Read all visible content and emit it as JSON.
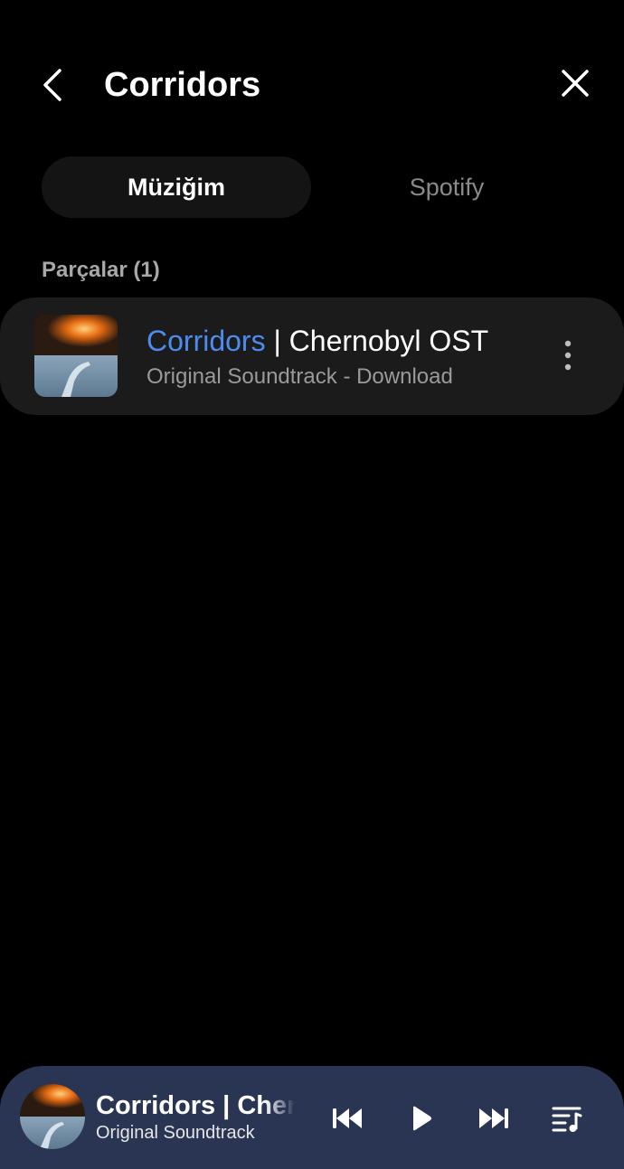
{
  "header": {
    "title": "Corridors",
    "back_icon": "chevron-left-icon",
    "close_icon": "close-icon"
  },
  "tabs": [
    {
      "label": "Müziğim",
      "active": true
    },
    {
      "label": "Spotify",
      "active": false
    }
  ],
  "section": {
    "label": "Parçalar (1)"
  },
  "tracks": [
    {
      "title_match": "Corridors",
      "title_rest": " | Chernobyl OST",
      "subtitle": "Original Soundtrack - Download",
      "more_icon": "more-vertical-icon"
    }
  ],
  "mini_player": {
    "title": "Corridors | Chernobyl OST",
    "subtitle": "Original Soundtrack",
    "controls": [
      "previous-icon",
      "play-icon",
      "next-icon",
      "playlist-icon"
    ]
  },
  "colors": {
    "background": "#000000",
    "accent": "#4c8cf0",
    "card": "#1b1b1b",
    "player_bg": "#2a3553"
  }
}
